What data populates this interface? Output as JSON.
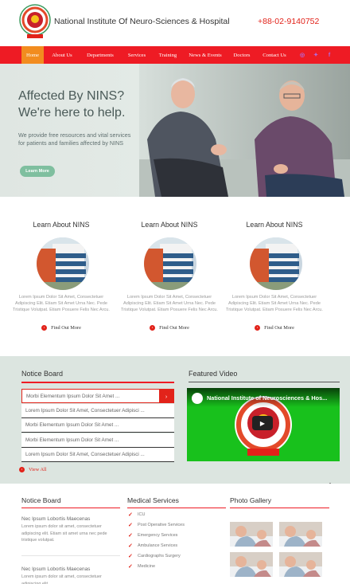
{
  "header": {
    "title": "National Institute Of Neuro-Sciences & Hospital",
    "phone": "+88-02-9140752",
    "logo_icon": "nins-logo-icon"
  },
  "nav": {
    "items": [
      "Home",
      "About Us",
      "Departments",
      "Services",
      "Training",
      "News & Events",
      "Doctors",
      "Contact Us"
    ],
    "active": "Home",
    "social_icons": [
      "instagram-icon",
      "twitter-icon",
      "facebook-icon"
    ],
    "bar_color": "#ee1b24",
    "active_color": "#f28c1f"
  },
  "hero": {
    "title": "Affected By NINS? We're here to help.",
    "text": "We provide free resources and vital services for patients and families affected by NINS",
    "button": "Learn More"
  },
  "learn": {
    "cards": [
      {
        "title": "Learn About NINS",
        "text": "Lorem Ipsum Dolor Sit Amet, Consectetuer Adipiscing Elit. Etiam Sit Amet Urna Nec. Pede Tristique Volutpat. Etiam Posuere Felis Nec Arcu.",
        "link": "Find Out More"
      },
      {
        "title": "Learn About NINS",
        "text": "Lorem Ipsum Dolor Sit Amet, Consectetuer Adipiscing Elit. Etiam Sit Amet Urna Nec. Pede Tristique Volutpat. Etiam Posuere Felis Nec Arcu.",
        "link": "Find Out More"
      },
      {
        "title": "Learn About NINS",
        "text": "Lorem Ipsum Dolor Sit Amet, Consectetuer Adipiscing Elit. Etiam Sit Amet Urna Nec. Pede Tristique Volutpat. Etiam Posuere Felis Nec Arcu.",
        "link": "Find Out More"
      }
    ]
  },
  "board": {
    "heading": "Notice Board",
    "items": [
      "Morbi Elementum Ipsum Dolor Sit Amet ...",
      "Lorem Ipsum Dolor Sit Amet, Consectetuer Adipisci ...",
      "Morbi Elementum Ipsum Dolor Sit Amet ...",
      "Morbi Elementum Ipsum Dolor Sit Amet ...",
      "Lorem Ipsum Dolor Sit Amet, Consectetuer Adipisci ..."
    ],
    "view_all": "View All"
  },
  "video": {
    "heading": "Featured Video",
    "title": "National Institute of Neurosciences & Hos...",
    "bg_color": "#18c11c"
  },
  "footer": {
    "notice_heading": "Notice Board",
    "notices": [
      {
        "title": "Nec Ipsum Lobortis Maecenas",
        "text": "Lorem ipsum dolor sit amet, consectetuer adipiscing elit. Etiam sit amet urna nec pede tristique volutpat."
      },
      {
        "title": "Nec Ipsum Lobortis Maecenas",
        "text": "Lorem ipsum dolor sit amet, consectetuer adipiscing elit."
      }
    ],
    "services_heading": "Medical Services",
    "services": [
      "ICU",
      "Post Operative Services",
      "Emergency Services",
      "Ambulance Services",
      "Cardiographs Surgery",
      "Medicine"
    ],
    "gallery_heading": "Photo Gallery"
  }
}
